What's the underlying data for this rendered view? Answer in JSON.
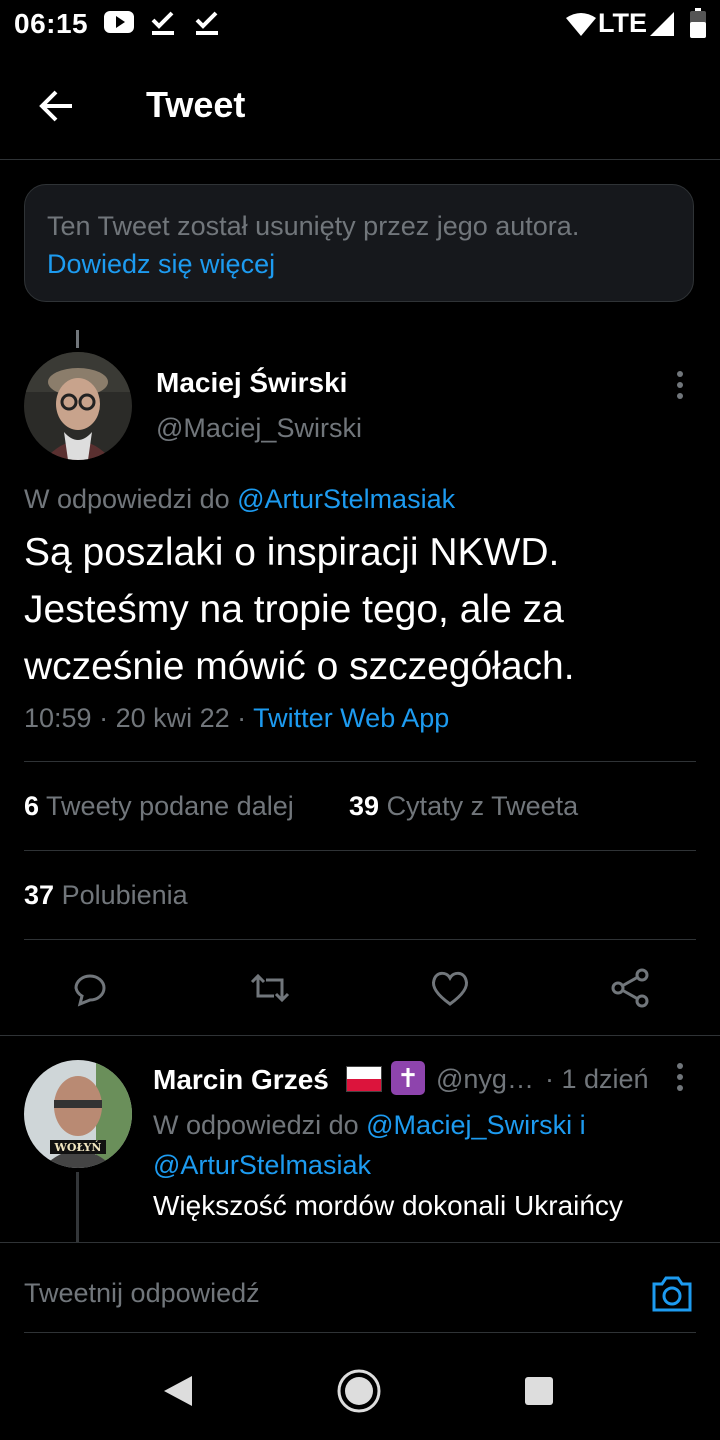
{
  "status_bar": {
    "time": "06:15",
    "network": "LTE"
  },
  "header": {
    "title": "Tweet"
  },
  "deleted_notice": {
    "text": "Ten Tweet został usunięty przez jego autora.",
    "link": "Dowiedz się więcej"
  },
  "tweet": {
    "author_name": "Maciej Świrski",
    "author_handle": "@Maciej_Swirski",
    "reply_prefix": "W odpowiedzi do ",
    "reply_to": "@ArturStelmasiak",
    "text_lines": [
      "Są poszlaki o inspiracji NKWD.",
      "Jesteśmy na tropie tego, ale za",
      "wcześnie mówić o szczegółach."
    ],
    "time": "10:59",
    "date": "20 kwi 22",
    "source": "Twitter Web App",
    "retweets_count": "6",
    "retweets_label": "Tweety podane dalej",
    "quotes_count": "39",
    "quotes_label": "Cytaty z Tweeta",
    "likes_count": "37",
    "likes_label": "Polubienia"
  },
  "actions": [
    "reply-icon",
    "retweet-icon",
    "like-icon",
    "share-icon"
  ],
  "reply": {
    "author_name": "Marcin Grześ",
    "author_handle": "@nyg…",
    "age": "· 1 dzień",
    "reply_prefix": "W odpowiedzi do ",
    "mention1": "@Maciej_Swirski",
    "conj": " i",
    "mention2": "@ArturStelmasiak",
    "text": "Większość mordów dokonali Ukraińcy",
    "cross_glyph": "✝"
  },
  "compose": {
    "placeholder": "Tweetnij odpowiedź"
  },
  "colors": {
    "accent": "#1d9bf0",
    "background": "#000000",
    "muted": "#71767b"
  }
}
